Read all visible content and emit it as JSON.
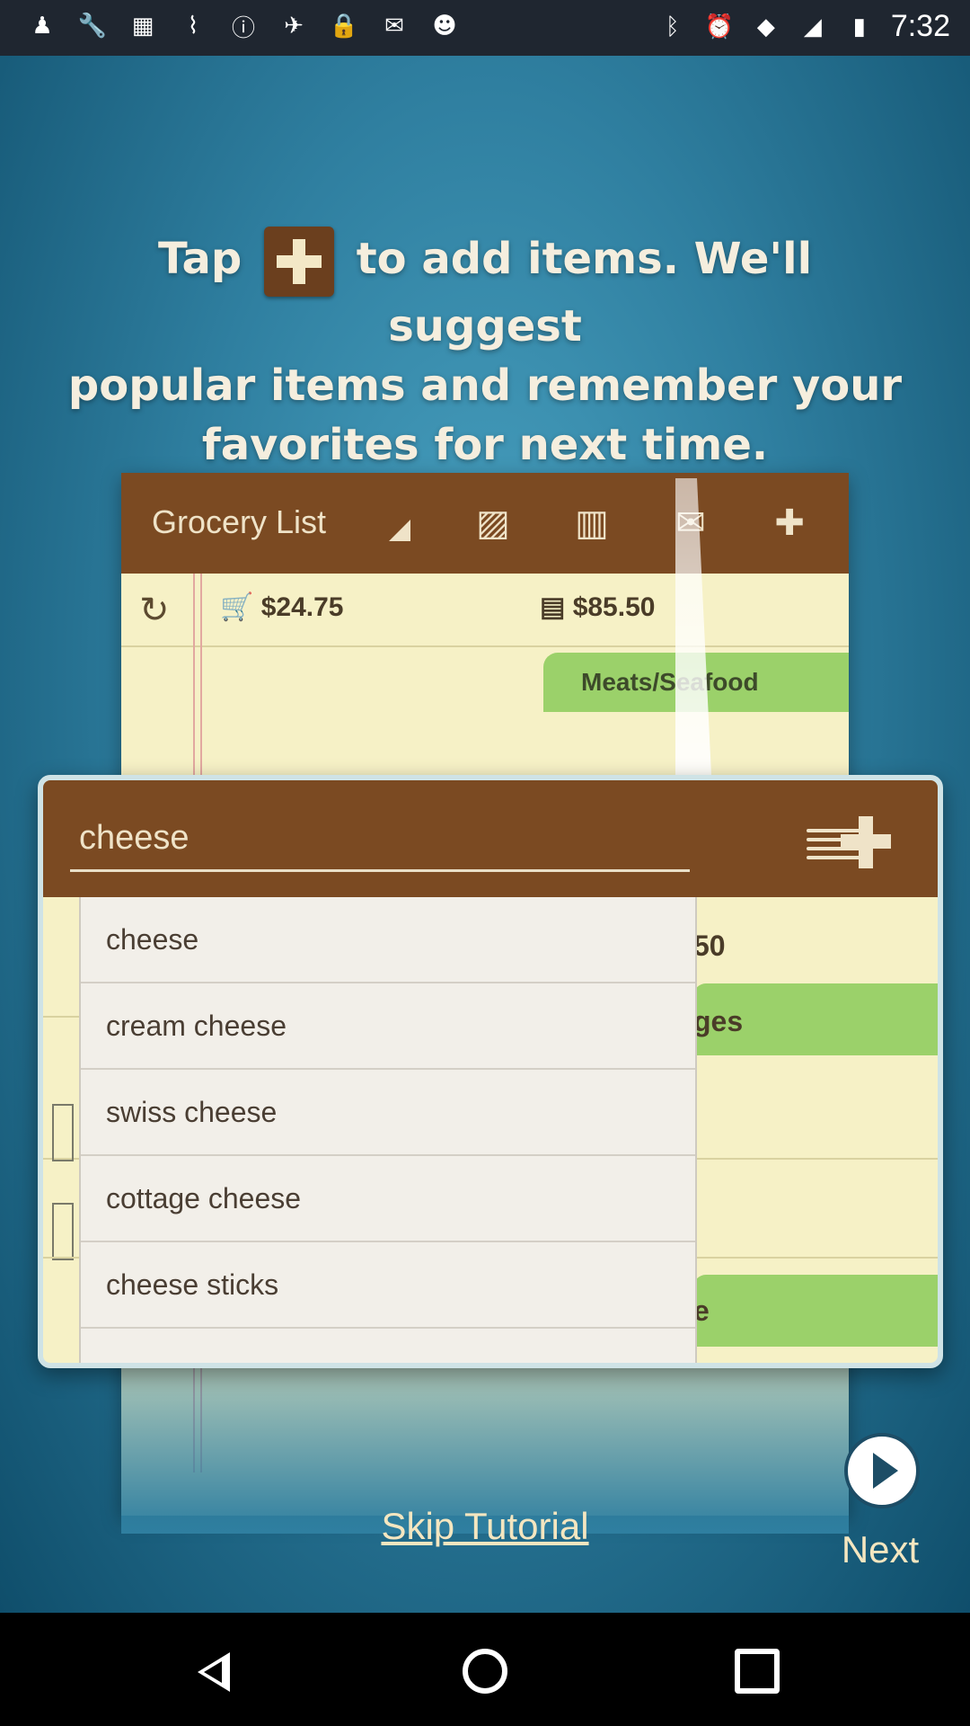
{
  "status_bar": {
    "time": "7:32",
    "left_icons": [
      "person-icon",
      "wrench-icon",
      "image-icon",
      "signal-icon",
      "alert-icon",
      "satellite-icon",
      "lock-icon",
      "inbox-icon",
      "android-icon"
    ],
    "right_icons": [
      "bluetooth-icon",
      "alarm-icon",
      "wifi-icon",
      "signal-icon",
      "battery-icon"
    ]
  },
  "tutorial": {
    "line1_before": "Tap",
    "line1_after": "to add items. We'll suggest",
    "line2": "popular items and remember your",
    "line3": "favorites for next time."
  },
  "app_preview": {
    "title": "Grocery List",
    "cart_total": "$24.75",
    "list_total": "$85.50",
    "category_tab": "Meats/Seafood",
    "header_icons": [
      "percent-coupon-icon",
      "barcode-icon",
      "mail-icon",
      "plus-icon"
    ]
  },
  "popup": {
    "search_value": "cheese",
    "suggestions": [
      "cheese",
      "cream cheese",
      "swiss cheese",
      "cottage cheese",
      "cheese sticks"
    ],
    "behind_row_1": "50",
    "behind_row_2": "ges",
    "behind_row_3": "e"
  },
  "controls": {
    "skip_label": "Skip Tutorial",
    "next_label": "Next"
  },
  "colors": {
    "header_brown": "#7b4a22",
    "paper": "#f6f1c6",
    "green_tab": "#9bd16a",
    "background_blue": "#2f7fa0"
  }
}
